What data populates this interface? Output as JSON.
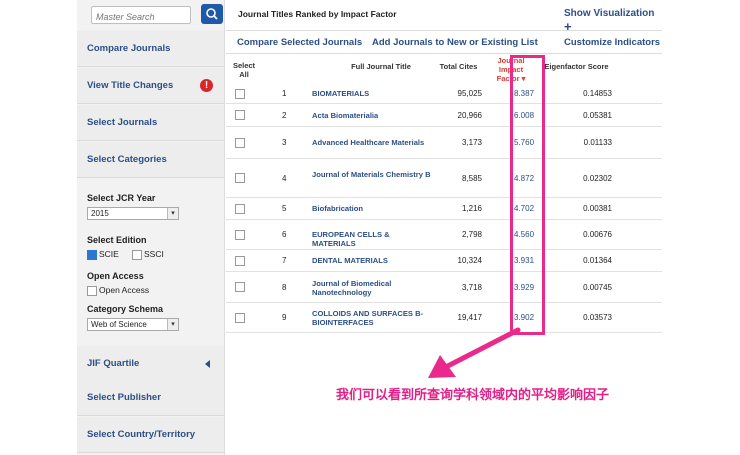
{
  "search": {
    "placeholder": "Master Search"
  },
  "sidebar": {
    "items": [
      {
        "label": "Compare Journals"
      },
      {
        "label": "View Title Changes"
      },
      {
        "label": "Select Journals"
      },
      {
        "label": "Select Categories"
      }
    ],
    "jcr_year": {
      "label": "Select JCR Year",
      "value": "2015"
    },
    "edition": {
      "label": "Select Edition",
      "opt1": "SCIE",
      "opt2": "SSCI"
    },
    "open_access": {
      "label": "Open Access",
      "opt": "Open Access"
    },
    "schema": {
      "label": "Category Schema",
      "value": "Web of Science"
    },
    "bottom_items": [
      {
        "label": "JIF Quartile"
      },
      {
        "label": "Select Publisher"
      },
      {
        "label": "Select Country/Territory"
      }
    ]
  },
  "main": {
    "title": "Journal Titles Ranked by Impact Factor",
    "show_viz": "Show Visualization",
    "toolbar": {
      "compare": "Compare Selected Journals",
      "add": "Add Journals to New or Existing List",
      "customize": "Customize Indicators"
    },
    "headers": {
      "select": "Select",
      "all": "All",
      "title": "Full Journal Title",
      "cites": "Total Cites",
      "jif1": "Journal",
      "jif2": "Impact",
      "jif3": "Factor",
      "eigen": "Eigenfactor Score"
    },
    "rows": [
      {
        "rank": "1",
        "title": "BIOMATERIALS",
        "cites": "95,025",
        "jif": "8.387",
        "eigen": "0.14853"
      },
      {
        "rank": "2",
        "title": "Acta Biomaterialia",
        "cites": "20,966",
        "jif": "6.008",
        "eigen": "0.05381"
      },
      {
        "rank": "3",
        "title": "Advanced Healthcare Materials",
        "cites": "3,173",
        "jif": "5.760",
        "eigen": "0.01133"
      },
      {
        "rank": "4",
        "title": "Journal of Materials Chemistry B",
        "cites": "8,585",
        "jif": "4.872",
        "eigen": "0.02302"
      },
      {
        "rank": "5",
        "title": "Biofabrication",
        "cites": "1,216",
        "jif": "4.702",
        "eigen": "0.00381"
      },
      {
        "rank": "6",
        "title": "EUROPEAN CELLS & MATERIALS",
        "cites": "2,798",
        "jif": "4.560",
        "eigen": "0.00676"
      },
      {
        "rank": "7",
        "title": "DENTAL MATERIALS",
        "cites": "10,324",
        "jif": "3.931",
        "eigen": "0.01364"
      },
      {
        "rank": "8",
        "title": "Journal of Biomedical Nanotechnology",
        "cites": "3,718",
        "jif": "3.929",
        "eigen": "0.00745"
      },
      {
        "rank": "9",
        "title": "COLLOIDS AND SURFACES B-BIOINTERFACES",
        "cites": "19,417",
        "jif": "3.902",
        "eigen": "0.03573"
      }
    ]
  },
  "annotation": "我们可以看到所查询学科领域内的平均影响因子",
  "colors": {
    "accent": "#2b4f86",
    "highlight": "#ea2a8a",
    "alert": "#d9262b"
  }
}
